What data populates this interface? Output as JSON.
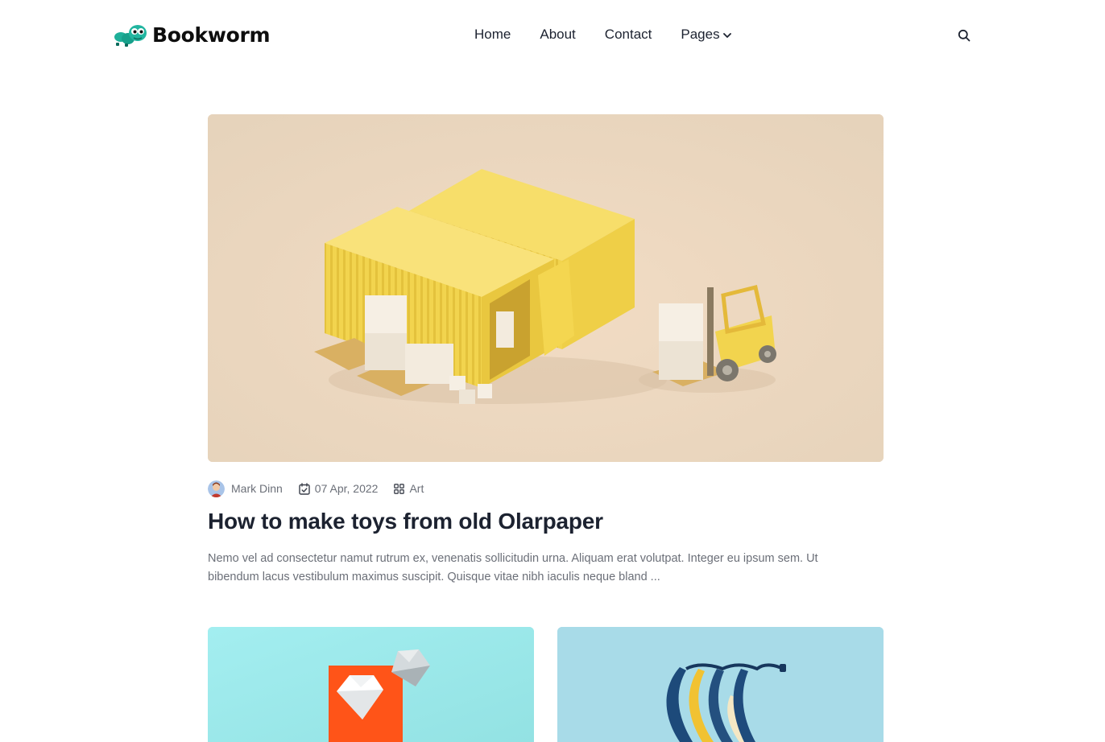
{
  "brand": {
    "name": "Bookworm"
  },
  "nav": {
    "items": [
      {
        "label": "Home"
      },
      {
        "label": "About"
      },
      {
        "label": "Contact"
      },
      {
        "label": "Pages",
        "has_dropdown": true
      }
    ]
  },
  "header": {
    "search_icon": "search-icon"
  },
  "featured": {
    "image_subject": "yellow shipping containers with cardboard boxes and forklift",
    "author": "Mark Dinn",
    "date": "07 Apr, 2022",
    "category": "Art",
    "title": "How to make toys from old Olarpaper",
    "excerpt": "Nemo vel ad consectetur namut rutrum ex, venenatis sollicitudin urna. Aliquam erat volutpat. Integer eu ipsum sem. Ut bibendum lacus vestibulum maximus suscipit. Quisque vitae nibh iaculis neque bland ..."
  },
  "cards": [
    {
      "image_subject": "paper diamonds on orange card, turquoise background"
    },
    {
      "image_subject": "blue and yellow bananas on light blue background"
    }
  ],
  "colors": {
    "text_dark": "#1c2230",
    "text_muted": "#6b6f78",
    "brand_green": "#1fb09a",
    "featured_bg": "#ead7c0",
    "container_yellow": "#f2d44e"
  }
}
